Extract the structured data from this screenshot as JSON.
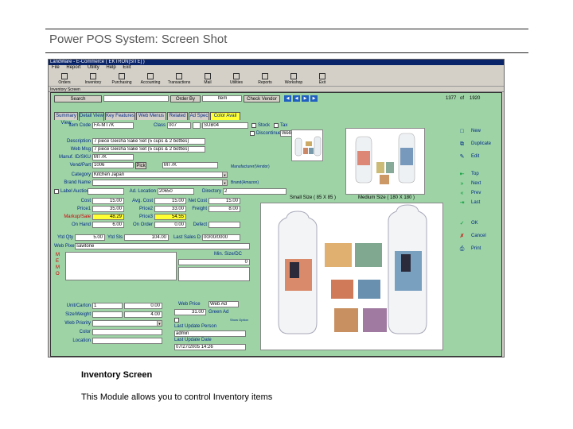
{
  "slide": {
    "title": "Power POS System: Screen Shot",
    "caption_title": "Inventory Screen",
    "caption_body": "This Module allows you to control Inventory items"
  },
  "app": {
    "title": "LandWare - E-Commerce ( EKTRON[SITE] )",
    "menu": [
      "File",
      "Report",
      "Utility",
      "Help",
      "Exit"
    ],
    "toolbar": [
      "Orders",
      "Inventory",
      "Purchasing",
      "Accounting",
      "Transactions",
      "Mail",
      "Utilities",
      "Reports",
      "Workshop",
      "Exit"
    ],
    "window_title": "Inventory Screen"
  },
  "inventory": {
    "search_label": "Search",
    "order_by_label": "Order By",
    "order_by_value": "Item",
    "check_vendor": "Check Vendor",
    "record_current": "1377",
    "record_of": "of",
    "record_total": "1920",
    "tabs": [
      "Summary View",
      "Detail View",
      "Key Features",
      "Web Menus",
      "Related",
      "Ad Spec",
      "Color Avail"
    ],
    "item_code_label": "Item Code",
    "item_code_value": "FA-MT7K",
    "class_label": "Class",
    "class_value": "007",
    "sub_value": "SUB04",
    "stock_label": "Stock",
    "tax_label": "Tax",
    "discontinue_label": "Discontinue",
    "web_post_label": "Web Post",
    "description_label": "Description",
    "description_value": "7 piece Geisha Sake Set (5 cups & 2 bottles)",
    "web_msg_label": "Web Msg",
    "web_msg_value": "7 piece Geisha Sake Set (5 cups & 2 bottles)",
    "manuf_label": "Manuf. ID/SKU",
    "manuf_value": "MT7K",
    "vend_part_label": "Vend/Part",
    "vend_value": "1006",
    "vend_btn": "Pick",
    "part_value": "MT7K",
    "category_label": "Category",
    "category_value": "Kitchen Japan",
    "brand_label": "Brand Name",
    "manufacturer_hint": "Manufacturer(Vendor)",
    "brand_hint": "Brand(Amazon)",
    "label_auction": "Label  Auction",
    "ad_location_label": "Ad. Location",
    "ad_location_value": "20650",
    "directory_label": "Directory",
    "directory_value": "2",
    "small_size": "Small Size ( 85 X 85 )",
    "medium_size": "Medium Size ( 180 X 180 )",
    "cost_label": "Cost",
    "cost_value": "15.00",
    "avg_cost_label": "Avg. Cost",
    "avg_cost_value": "15.00",
    "net_cost_label": "Net Cost",
    "net_cost_value": "15.00",
    "price_label": "Price1",
    "price_value": "35.00",
    "price2_label": "Price2",
    "price2_value": "33.00",
    "freight_label": "Freight",
    "freight_value": "8.00",
    "markup_label": "Markup/Sale",
    "markup_value": "48.29",
    "price3_label": "Price3",
    "price3_value": "54.55",
    "on_hand_label": "On Hand",
    "on_hand_value": "6.00",
    "on_order_label": "On Order",
    "on_order_value": "0.00",
    "defect_label": "Defect",
    "ytd_qty_label": "Ytd Qty",
    "ytd_qty_value": "5.00",
    "ytd_sls_label": "Ytd Sls",
    "ytd_sls_value": "104.00",
    "last_sales_label": "Last Sales D",
    "last_sales_value": "00/00/0000",
    "web_pixel_label": "Web Pixel",
    "web_pixel_value": "sawtone",
    "side_letters": [
      "M",
      "E",
      "M",
      "O"
    ],
    "min_size_label": "Min. Size/DC",
    "min_size_value": "0",
    "unit_label": "Unit/Carton",
    "unit_value": "1",
    "unit_val2": "0.00",
    "size_weight_label": "Size/Weight",
    "size_weight_value": "4.00",
    "web_priority_label": "Web Priority",
    "color_label": "Color",
    "location_label": "Location",
    "web_price_label": "Web Price",
    "web_ad_label": "Web Ad",
    "web_price_value": "31.00",
    "green_ad_label": "Green Ad",
    "show_option": "Show Option",
    "last_update_person_label": "Last Update Person",
    "last_update_person_value": "admin",
    "last_update_date_label": "Last Update Date",
    "last_update_date_value": "07/27/2005 14:26",
    "side_buttons": [
      "New",
      "Duplicate",
      "Edit",
      "Top",
      "Next",
      "Prev",
      "Last",
      "OK",
      "Cancel",
      "Print"
    ]
  }
}
